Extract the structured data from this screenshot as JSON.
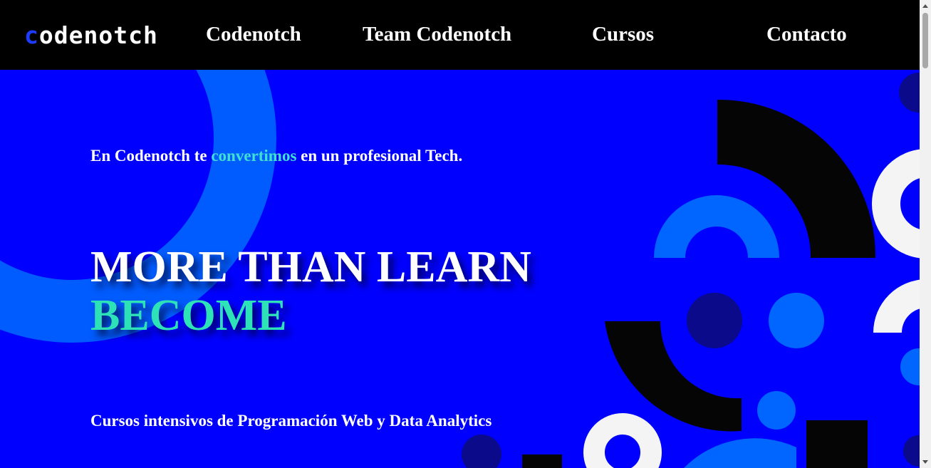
{
  "nav": {
    "logo_text_main": "odenotch",
    "logo_text_first": "c",
    "links": [
      {
        "label": "Codenotch"
      },
      {
        "label": "Team Codenotch"
      },
      {
        "label": "Cursos"
      },
      {
        "label": "Contacto"
      }
    ]
  },
  "hero": {
    "tagline_before": "En Codenotch te ",
    "tagline_accent": "convertimos",
    "tagline_after": " en un profesional Tech.",
    "headline_line1": "MORE THAN LEARN",
    "headline_line2": "BECOME",
    "subtitle": "Cursos intensivos de Programación Web y Data Analytics"
  },
  "colors": {
    "background": "#0000ff",
    "nav_background": "#000000",
    "accent_text": "#40e0d0",
    "become_text": "#2ee2b8",
    "shape_light_blue": "#0066ff",
    "shape_dark_navy": "#0a0a8a",
    "shape_black": "#050505",
    "shape_white": "#f4f4f4"
  }
}
